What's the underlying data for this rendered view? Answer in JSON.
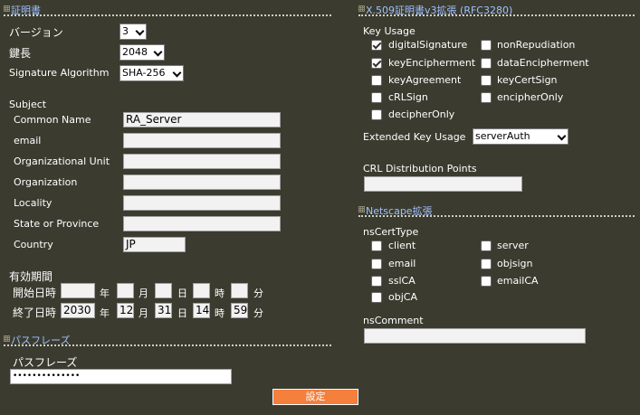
{
  "cert": {
    "header": "証明書",
    "version_label": "バージョン",
    "version_value": "3",
    "keylen_label": "鍵長",
    "keylen_value": "2048",
    "sigalg_label": "Signature Algorithm",
    "sigalg_value": "SHA-256",
    "subject_label": "Subject",
    "fields": [
      {
        "label": "Common Name",
        "value": "RA_Server"
      },
      {
        "label": "email",
        "value": ""
      },
      {
        "label": "Organizational Unit",
        "value": ""
      },
      {
        "label": "Organization",
        "value": ""
      },
      {
        "label": "Locality",
        "value": ""
      },
      {
        "label": "State or Province",
        "value": ""
      },
      {
        "label": "Country",
        "value": "JP"
      }
    ],
    "validity_label": "有効期間",
    "start_label": "開始日時",
    "end_label": "終了日時",
    "unit_year": "年",
    "unit_month": "月",
    "unit_day": "日",
    "unit_hour": "時",
    "unit_min": "分",
    "start": {
      "year": "",
      "month": "",
      "day": "",
      "hour": "",
      "min": ""
    },
    "end": {
      "year": "2030",
      "month": "12",
      "day": "31",
      "hour": "14",
      "min": "59"
    }
  },
  "pass": {
    "header": "パスフレーズ",
    "label": "パスフレーズ",
    "value": "••••••••••••••"
  },
  "submit_label": "設定",
  "x509": {
    "header": "X.509証明書v3拡張 (RFC3280)",
    "key_usage_label": "Key Usage",
    "key_usage": [
      {
        "label": "digitalSignature",
        "checked": true
      },
      {
        "label": "nonRepudiation",
        "checked": false
      },
      {
        "label": "keyEncipherment",
        "checked": true
      },
      {
        "label": "dataEncipherment",
        "checked": false
      },
      {
        "label": "keyAgreement",
        "checked": false
      },
      {
        "label": "keyCertSign",
        "checked": false
      },
      {
        "label": "cRLSign",
        "checked": false
      },
      {
        "label": "encipherOnly",
        "checked": false
      },
      {
        "label": "decipherOnly",
        "checked": false
      }
    ],
    "ext_key_usage_label": "Extended Key Usage",
    "ext_key_usage_value": "serverAuth",
    "crl_label": "CRL Distribution Points",
    "crl_value": ""
  },
  "netscape": {
    "header": "Netscape拡張",
    "certtype_label": "nsCertType",
    "certtypes": [
      {
        "label": "client",
        "checked": false
      },
      {
        "label": "server",
        "checked": false
      },
      {
        "label": "email",
        "checked": false
      },
      {
        "label": "objsign",
        "checked": false
      },
      {
        "label": "sslCA",
        "checked": false
      },
      {
        "label": "emailCA",
        "checked": false
      },
      {
        "label": "objCA",
        "checked": false
      }
    ],
    "comment_label": "nsComment",
    "comment_value": ""
  }
}
